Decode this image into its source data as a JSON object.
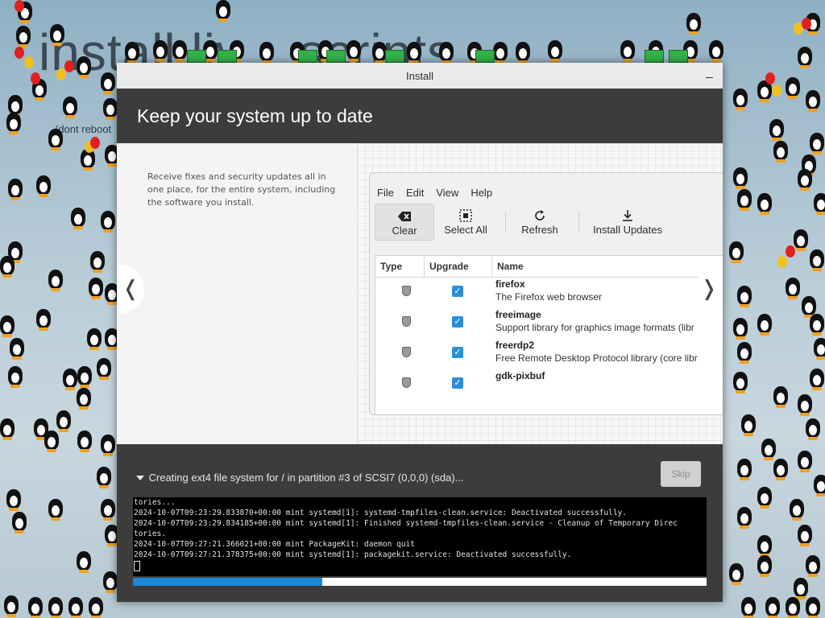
{
  "desktop": {
    "background_title": "install liv... scripts",
    "background_note": "(dont reboot"
  },
  "window": {
    "title": "Install",
    "heading": "Keep your system up to date",
    "slide": {
      "description": "Receive fixes and security updates all in one place, for the entire system, including the software you install.",
      "app": {
        "menu": [
          "File",
          "Edit",
          "View",
          "Help"
        ],
        "toolbar": {
          "clear": "Clear",
          "select_all": "Select All",
          "refresh": "Refresh",
          "install_updates": "Install Updates"
        },
        "columns": [
          "Type",
          "Upgrade",
          "Name"
        ],
        "rows": [
          {
            "name": "firefox",
            "description": "The Firefox web browser",
            "checked": true
          },
          {
            "name": "freeimage",
            "description": "Support library for graphics image formats (libr",
            "checked": true
          },
          {
            "name": "freerdp2",
            "description": "Free Remote Desktop Protocol library (core libr",
            "checked": true
          },
          {
            "name": "gdk-pixbuf",
            "description": "",
            "checked": true
          }
        ]
      }
    },
    "nav": {
      "prev": "❬",
      "next": "❭"
    },
    "status": "Creating ext4 file system for / in partition #3 of SCSI7 (0,0,0) (sda)...",
    "skip_label": "Skip",
    "log_lines": [
      "tories...",
      "2024-10-07T09:23:29.833870+00:00 mint systemd[1]: systemd-tmpfiles-clean.service: Deactivated successfully.",
      "2024-10-07T09:23:29.834185+00:00 mint systemd[1]: Finished systemd-tmpfiles-clean.service - Cleanup of Temporary Direc",
      "tories.",
      "2024-10-07T09:27:21.366021+00:00 mint PackageKit: daemon quit",
      "2024-10-07T09:27:21.378375+00:00 mint systemd[1]: packagekit.service: Deactivated successfully."
    ],
    "progress_fraction": 0.33,
    "accent_color": "#1a87d6"
  }
}
